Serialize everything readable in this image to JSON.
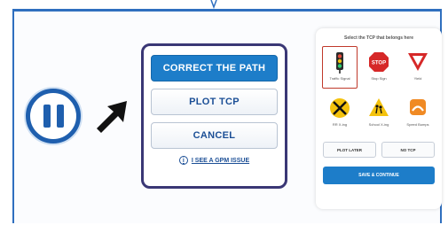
{
  "pause": {
    "icon": "pause-icon"
  },
  "pointer": {
    "icon": "arrow-pointer-icon"
  },
  "menu": {
    "buttons": [
      {
        "label": "CORRECT THE PATH",
        "primary": true
      },
      {
        "label": "PLOT TCP",
        "primary": false
      },
      {
        "label": "CANCEL",
        "primary": false
      }
    ],
    "help_icon_glyph": "i",
    "help_link": "I SEE A GPM ISSUE"
  },
  "tcp_panel": {
    "title": "Select the TCP that belongs here",
    "items": [
      {
        "label": "Traffic Signal",
        "icon": "traffic-light-icon",
        "selected": true
      },
      {
        "label": "Stop Sign",
        "icon": "stop-sign-icon",
        "selected": false
      },
      {
        "label": "Yield",
        "icon": "yield-sign-icon",
        "selected": false
      },
      {
        "label": "RR X-ing",
        "icon": "railroad-crossing-icon",
        "selected": false
      },
      {
        "label": "School X-ing",
        "icon": "school-crossing-icon",
        "selected": false
      },
      {
        "label": "Speed Bumps",
        "icon": "speed-bump-icon",
        "selected": false
      }
    ],
    "secondary_buttons": [
      "PLOT LATER",
      "NO TCP"
    ],
    "continue_label": "SAVE & CONTINUE"
  },
  "colors": {
    "accent": "#1d7dc9",
    "frame": "#2f6fbf",
    "menu_border": "#3a3775",
    "selected_border": "#c0392b"
  }
}
